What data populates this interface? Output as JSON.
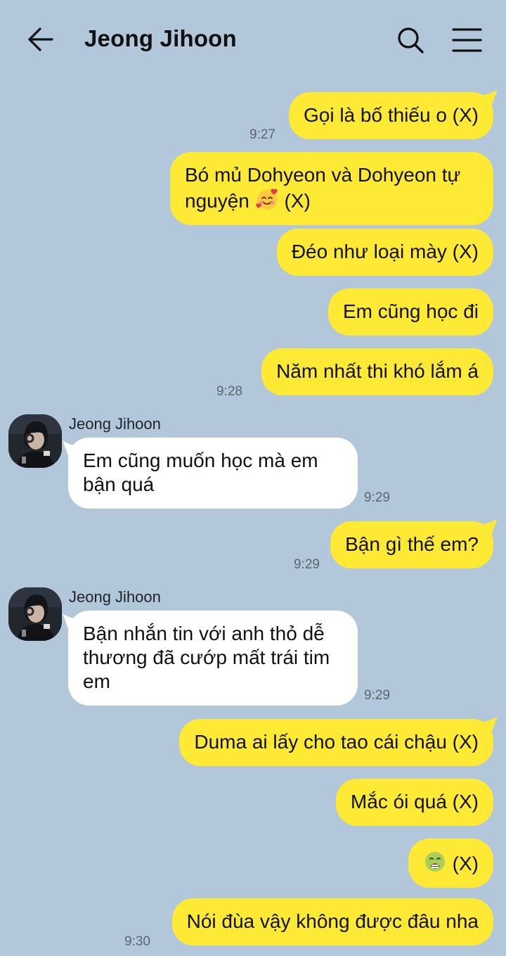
{
  "header": {
    "title": "Jeong Jihoon"
  },
  "colors": {
    "background": "#b2c7da",
    "my_bubble": "#fee934",
    "their_bubble": "#ffffff"
  },
  "icons": {
    "back": "back-arrow-icon",
    "search": "search-icon",
    "menu": "hamburger-menu-icon"
  },
  "messages": [
    {
      "from": "me",
      "text": "Gọi là bố thiếu o (X)",
      "time": "9:27"
    },
    {
      "from": "me",
      "line1": "Bó mủ Dohyeon và Dohyeon tự",
      "line2_pre": "nguyện",
      "line2_post": "(X)",
      "emoji": "smiling-face-with-hearts"
    },
    {
      "from": "me",
      "text": "Đéo như loại mày (X)"
    },
    {
      "from": "me",
      "text": "Em cũng học đi"
    },
    {
      "from": "me",
      "text": "Năm nhất thi khó lắm á",
      "time": "9:28"
    },
    {
      "from": "them",
      "sender": "Jeong Jihoon",
      "text": "Em cũng muốn học mà em bận quá",
      "time": "9:29"
    },
    {
      "from": "me",
      "text": "Bận gì thế em?",
      "time": "9:29"
    },
    {
      "from": "them",
      "sender": "Jeong Jihoon",
      "text": "Bận nhắn tin với anh thỏ dễ thương đã cướp mất trái tim em",
      "time": "9:29"
    },
    {
      "from": "me",
      "text": "Duma ai lấy cho tao cái chậu (X)"
    },
    {
      "from": "me",
      "text": "Mắc ói quá (X)"
    },
    {
      "from": "me",
      "text": "(X)",
      "emoji": "nauseated-face"
    },
    {
      "from": "me",
      "text": "Nói đùa vậy không được đâu nha",
      "time": "9:30"
    }
  ]
}
